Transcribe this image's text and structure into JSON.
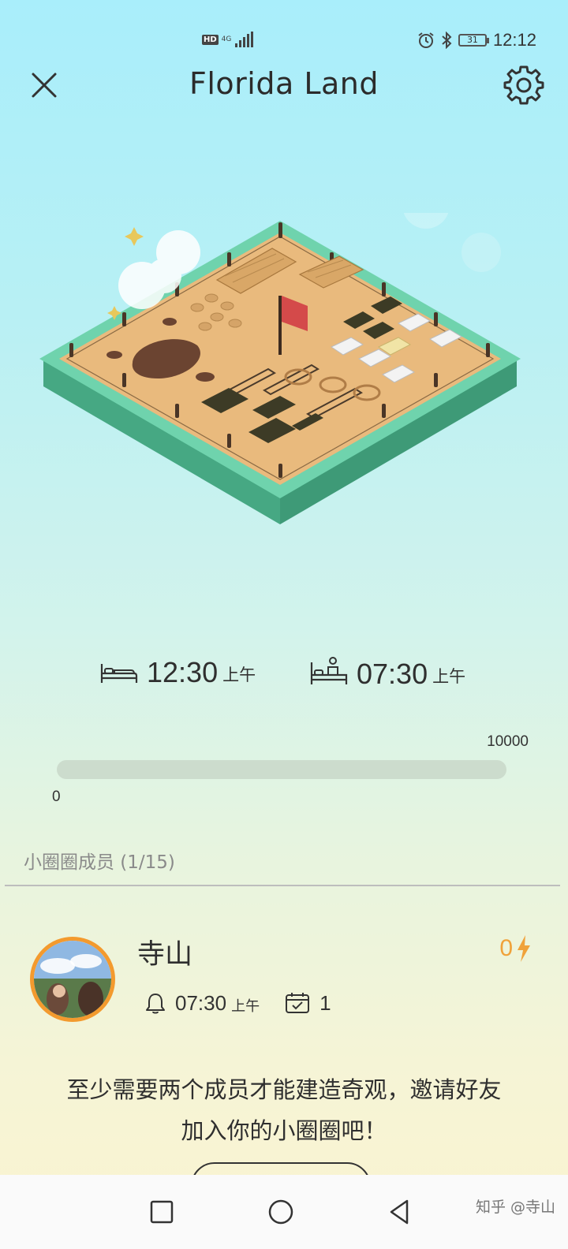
{
  "status_bar": {
    "hd": "HD",
    "network": "4G",
    "battery": "31",
    "time": "12:12",
    "icons": [
      "hd-icon",
      "signal-icon",
      "alarm-icon",
      "bluetooth-icon",
      "battery-icon"
    ]
  },
  "header": {
    "title": "Florida Land",
    "close_icon": "close-icon",
    "settings_icon": "gear-icon"
  },
  "sleep": {
    "bedtime": "12:30",
    "bedtime_period": "上午",
    "wake": "07:30",
    "wake_period": "上午"
  },
  "progress": {
    "min_label": "0",
    "max_label": "10000",
    "fraction": 0,
    "fill_color": "#f0a23a"
  },
  "members": {
    "label": "小圈圈成员 (1/15)",
    "items": [
      {
        "name": "寺山",
        "score": "0",
        "alarm_time": "07:30",
        "alarm_period": "上午",
        "checkin_count": "1"
      }
    ]
  },
  "invite": {
    "line1": "至少需要两个成员才能建造奇观，邀请好友",
    "line2": "加入你的小圈圈吧！"
  },
  "navbar": {
    "watermark": "知乎 @寺山",
    "icons": [
      "recent-apps-icon",
      "home-icon",
      "back-icon"
    ]
  },
  "colors": {
    "accent": "#f0a23a",
    "bg_top": "#a9eefb",
    "bg_bottom": "#fbf3d0",
    "island_green": "#5bc79e",
    "sand": "#e8b97c"
  }
}
